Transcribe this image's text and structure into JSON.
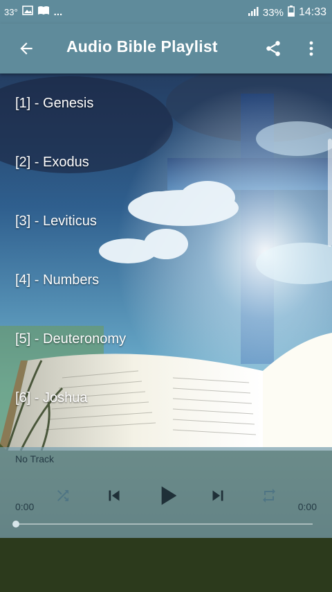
{
  "status_bar": {
    "temperature": "33°",
    "battery": "33%",
    "time": "14:33",
    "icons": [
      "weather-icon",
      "image-icon",
      "book-icon",
      "more-notifications-icon",
      "signal-icon",
      "battery-icon"
    ]
  },
  "app_bar": {
    "title": "Audio Bible Playlist",
    "icons": [
      "back-arrow-icon",
      "share-icon",
      "overflow-menu-icon"
    ],
    "color": "#5f8b9b"
  },
  "playlist": {
    "items": [
      {
        "label": "[1] - Genesis"
      },
      {
        "label": "[2] - Exodus"
      },
      {
        "label": "[3] - Leviticus"
      },
      {
        "label": "[4] - Numbers"
      },
      {
        "label": "[5] - Deuteronomy"
      },
      {
        "label": "[6] - Joshua"
      }
    ]
  },
  "player": {
    "track_name": "No Track",
    "current_time": "0:00",
    "total_time": "0:00",
    "progress": 0,
    "icons": [
      "shuffle-icon",
      "previous-icon",
      "play-icon",
      "next-icon",
      "repeat-icon"
    ]
  }
}
